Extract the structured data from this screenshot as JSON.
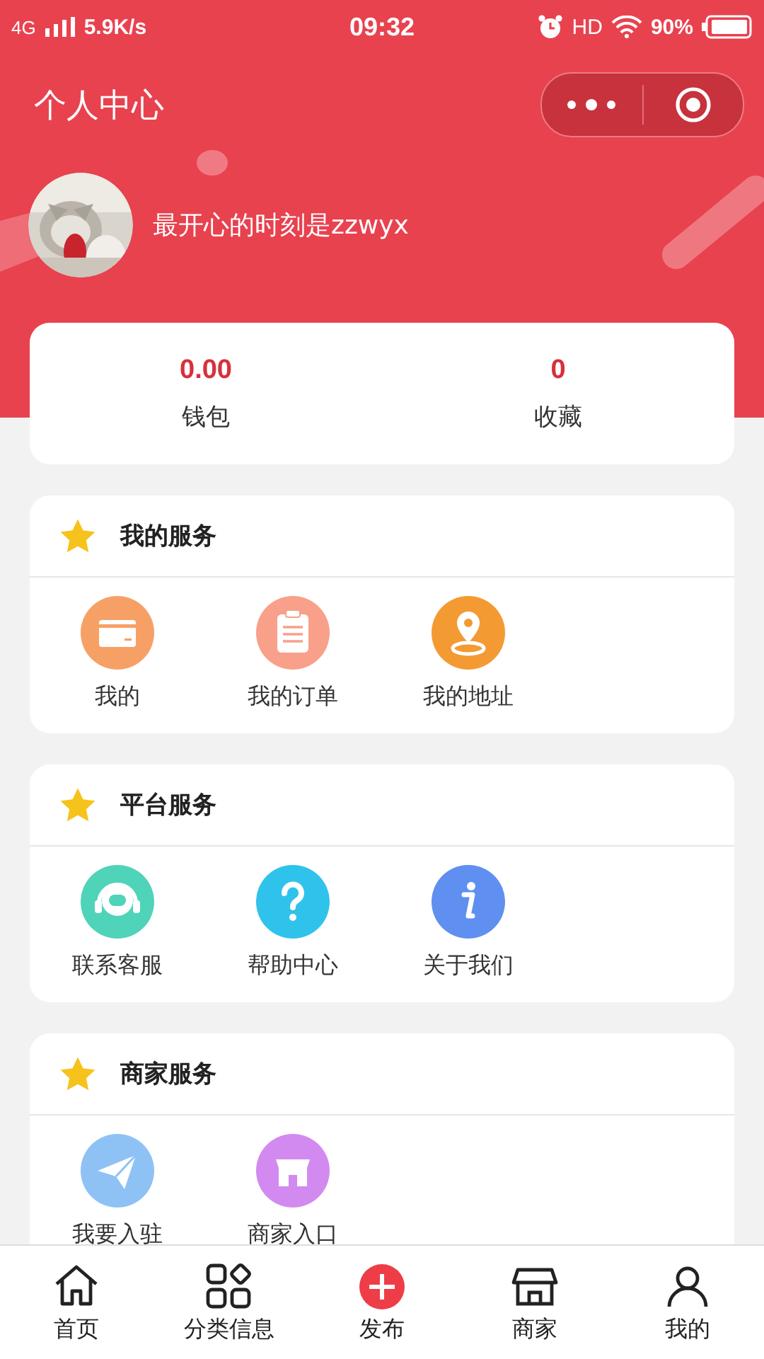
{
  "status_bar": {
    "network": "4G",
    "speed": "5.9K/s",
    "time": "09:32",
    "hd": "HD",
    "battery": "90%"
  },
  "title": "个人中心",
  "profile": {
    "name": "最开心的时刻是zzwyx"
  },
  "stats": [
    {
      "value": "0.00",
      "label": "钱包"
    },
    {
      "value": "0",
      "label": "收藏"
    }
  ],
  "sections": [
    {
      "title": "我的服务",
      "items": [
        {
          "label": "我的",
          "kind": "card",
          "color": "#f7a066"
        },
        {
          "label": "我的订单",
          "kind": "clipboard",
          "color": "#f8a08a"
        },
        {
          "label": "我的地址",
          "kind": "pin",
          "color": "#f39a33"
        }
      ]
    },
    {
      "title": "平台服务",
      "items": [
        {
          "label": "联系客服",
          "kind": "headset",
          "color": "#4fd3b9"
        },
        {
          "label": "帮助中心",
          "kind": "question",
          "color": "#2fc3ec"
        },
        {
          "label": "关于我们",
          "kind": "info",
          "color": "#5f8ff0"
        }
      ]
    },
    {
      "title": "商家服务",
      "items": [
        {
          "label": "我要入驻",
          "kind": "plane",
          "color": "#8ec2f5"
        },
        {
          "label": "商家入口",
          "kind": "shop",
          "color": "#d28af0"
        }
      ]
    }
  ],
  "tab_bar": [
    {
      "label": "首页",
      "kind": "home",
      "selected": false
    },
    {
      "label": "分类信息",
      "kind": "grid",
      "selected": false
    },
    {
      "label": "发布",
      "kind": "plus",
      "selected": false
    },
    {
      "label": "商家",
      "kind": "store",
      "selected": false
    },
    {
      "label": "我的",
      "kind": "user",
      "selected": false
    }
  ]
}
